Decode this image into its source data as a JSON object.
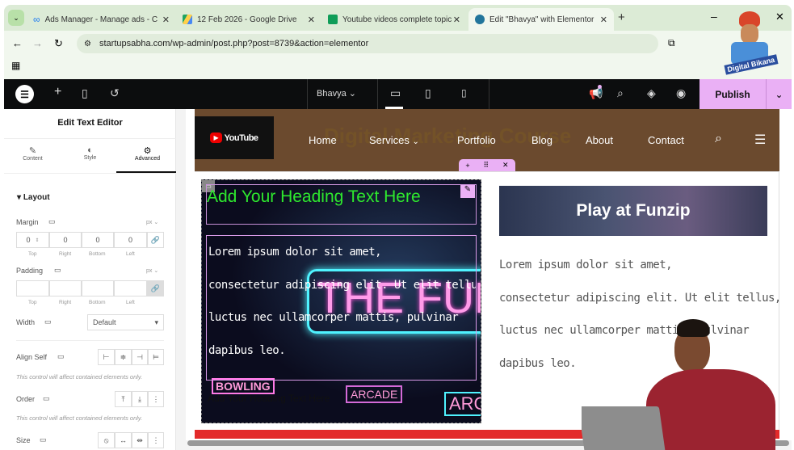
{
  "browser": {
    "tabs": [
      {
        "title": "Ads Manager - Manage ads - C",
        "icon": "meta-icon"
      },
      {
        "title": "12 Feb 2026 - Google Drive",
        "icon": "google-drive-icon"
      },
      {
        "title": "Youtube videos complete topic",
        "icon": "google-sheets-icon"
      },
      {
        "title": "Edit \"Bhavya\" with Elementor",
        "icon": "wordpress-icon",
        "active": true
      }
    ],
    "url": "startupsabha.com/wp-admin/post.php?post=8739&action=elementor",
    "channel_logo": "Digital Bikana"
  },
  "elementor": {
    "page_name": "Bhavya",
    "publish_label": "Publish",
    "panel": {
      "title": "Edit Text Editor",
      "tabs": [
        "Content",
        "Style",
        "Advanced"
      ],
      "active_tab": "Advanced",
      "section": "Layout",
      "margin": {
        "label": "Margin",
        "unit": "px",
        "values": [
          "0",
          "0",
          "0",
          "0"
        ],
        "sides": [
          "Top",
          "Right",
          "Bottom",
          "Left"
        ]
      },
      "padding": {
        "label": "Padding",
        "unit": "px",
        "values": [
          "",
          "",
          "",
          ""
        ],
        "sides": [
          "Top",
          "Right",
          "Bottom",
          "Left"
        ]
      },
      "width": {
        "label": "Width",
        "value": "Default"
      },
      "align_self": "Align Self",
      "order": "Order",
      "size": "Size",
      "note": "This control will affect contained elements only."
    }
  },
  "site": {
    "logo": "YouTube",
    "header_bg_text": "Digital Marketing Course",
    "nav": [
      "Home",
      "Services",
      "Portfolio",
      "Blog",
      "About",
      "Contact"
    ],
    "heading": "Add Your Heading Text Here",
    "heading2": "Add Your Heading Text Here",
    "neon_signs": [
      "THE FUN",
      "BOWLING",
      "ARCADE",
      "ARC"
    ],
    "lorem_lines": [
      "Lorem ipsum dolor sit amet,",
      "consectetur adipiscing elit. Ut elit tellus,",
      "luctus nec ullamcorper mattis, pulvinar",
      "dapibus leo."
    ],
    "image_title": "Play at Funzip",
    "colors": {
      "heading_green": "#2ee82e",
      "header_brown": "#6b4a2e",
      "publish_pink": "#eab0f5",
      "red_bar": "#e32a2a"
    }
  }
}
